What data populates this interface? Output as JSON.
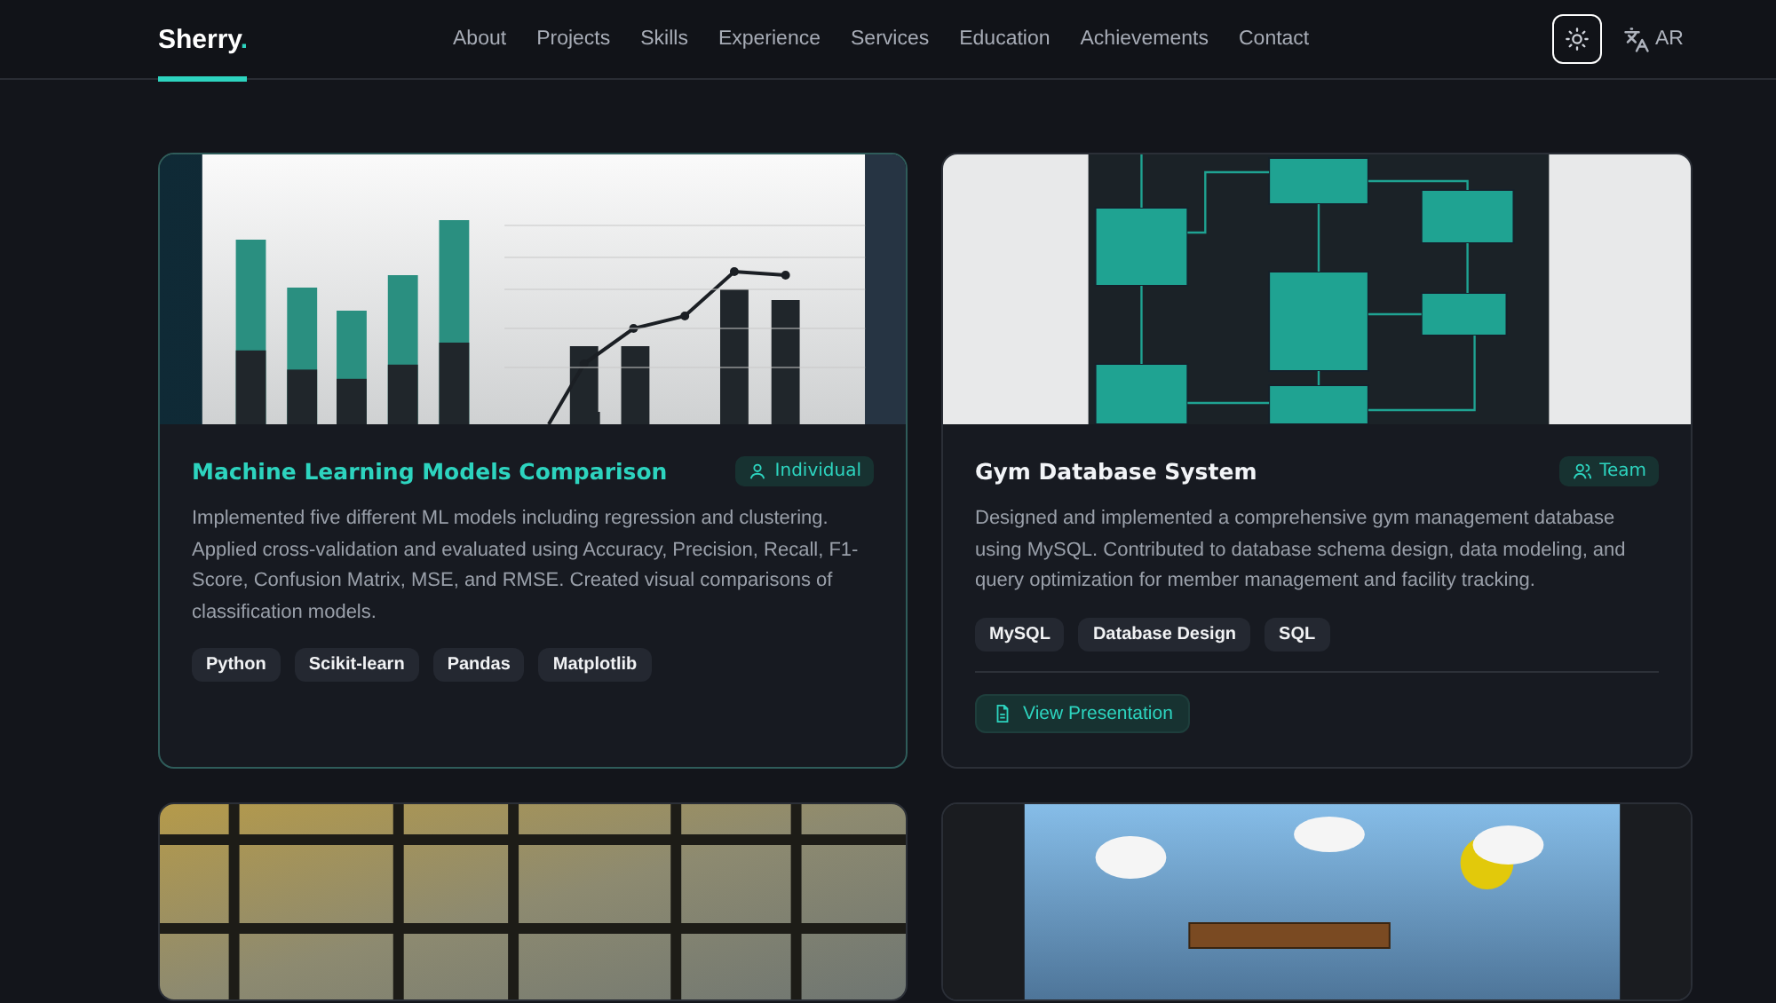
{
  "header": {
    "logo": "Sherry",
    "logo_mark": ".",
    "nav": [
      "About",
      "Projects",
      "Skills",
      "Experience",
      "Services",
      "Education",
      "Achievements",
      "Contact"
    ],
    "theme_toggle": {
      "focused": true
    },
    "language": "AR"
  },
  "projects": [
    {
      "kind": "chart",
      "title": "Machine Learning Models Comparison",
      "highlighted": true,
      "team": {
        "kind": "individual",
        "label": "Individual"
      },
      "description": "Implemented five different ML models including regression and clustering. Applied cross-validation and evaluated using Accuracy, Precision, Recall, F1-Score, Confusion Matrix, MSE, and RMSE. Created visual comparisons of classification models.",
      "tags": [
        "Python",
        "Scikit-learn",
        "Pandas",
        "Matplotlib"
      ]
    },
    {
      "kind": "diagram",
      "title": "Gym Database System",
      "highlighted": false,
      "team": {
        "kind": "team",
        "label": "Team"
      },
      "description": "Designed and implemented a comprehensive gym management database using MySQL. Contributed to database schema design, data modeling, and query optimization for member management and facility tracking.",
      "tags": [
        "MySQL",
        "Database Design",
        "SQL"
      ],
      "link": "View Presentation"
    },
    {
      "kind": "photo",
      "highlighted": false
    },
    {
      "kind": "game",
      "highlighted": false
    }
  ]
}
